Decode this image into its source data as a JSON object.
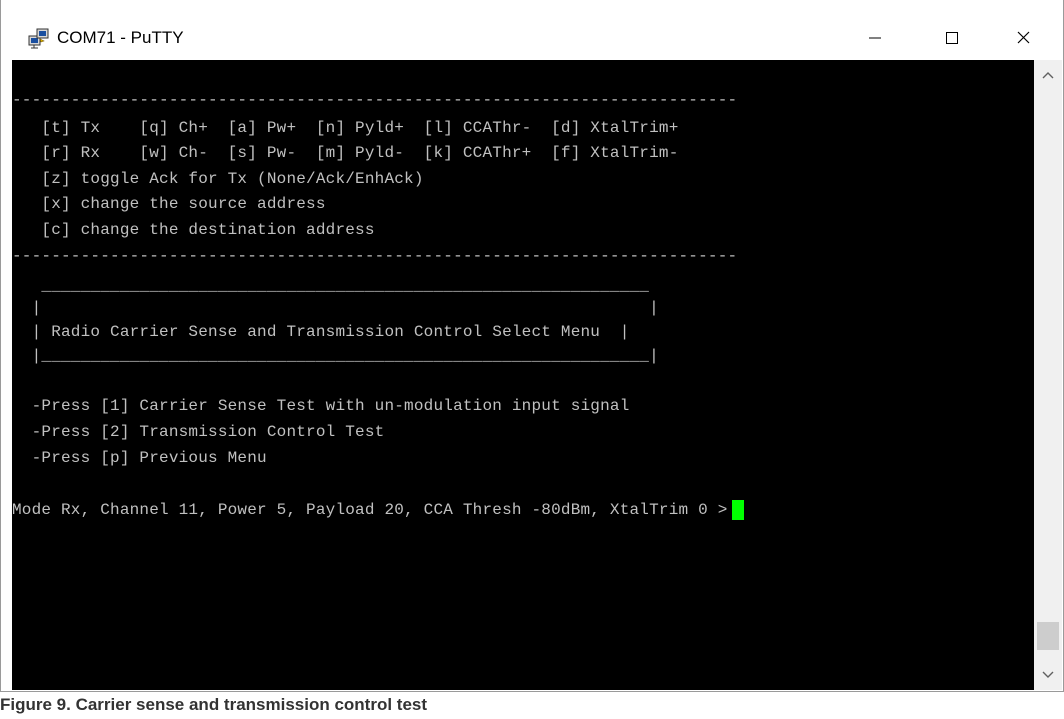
{
  "window": {
    "title": "COM71 - PuTTY",
    "icon": "putty-icon",
    "controls": {
      "minimize_icon": "minimize-icon",
      "maximize_icon": "maximize-icon",
      "close_icon": "close-icon"
    }
  },
  "terminal": {
    "lines": [
      "--------------------------------------------------------------------------",
      "   [t] Tx    [q] Ch+  [a] Pw+  [n] Pyld+  [l] CCAThr-  [d] XtalTrim+",
      "   [r] Rx    [w] Ch-  [s] Pw-  [m] Pyld-  [k] CCAThr+  [f] XtalTrim-",
      "   [z] toggle Ack for Tx (None/Ack/EnhAck)",
      "   [x] change the source address",
      "   [c] change the destination address",
      "--------------------------------------------------------------------------",
      "   ______________________________________________________________",
      "  |                                                              |",
      "  | Radio Carrier Sense and Transmission Control Select Menu  |",
      "  |______________________________________________________________|",
      "  -Press [1] Carrier Sense Test with un-modulation input signal",
      "  -Press [2] Transmission Control Test",
      "  -Press [p] Previous Menu",
      "Mode Rx, Channel 11, Power 5, Payload 20, CCA Thresh -80dBm, XtalTrim 0 >"
    ],
    "cursor_color": "#00ff00",
    "text_color": "#c0c0c0",
    "background": "#000000"
  },
  "scrollbar": {
    "up_icon": "scroll-up-icon",
    "down_icon": "scroll-down-icon"
  },
  "caption": "Figure 9.  Carrier sense and transmission control test"
}
